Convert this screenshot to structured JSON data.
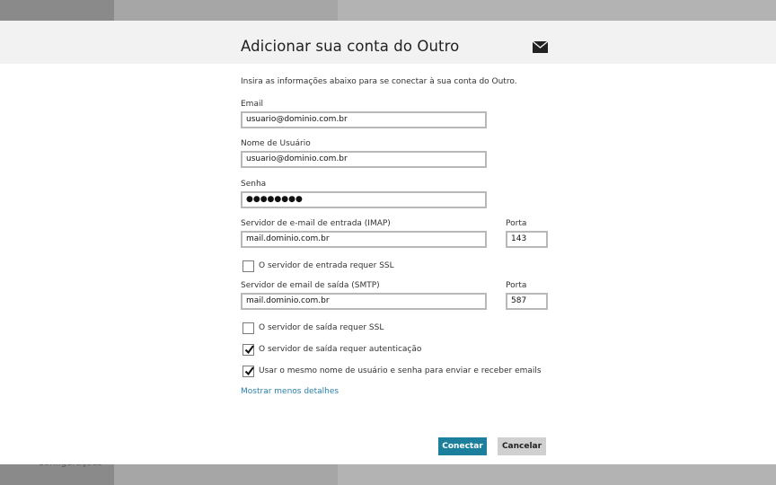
{
  "background": {
    "footer_label": "Configurações"
  },
  "dialog": {
    "title": "Adicionar sua conta do Outro",
    "intro": "Insira as informações abaixo para se conectar à sua conta do Outro.",
    "email": {
      "label": "Email",
      "value": "usuario@dominio.com.br"
    },
    "username": {
      "label": "Nome de Usuário",
      "value": "usuario@dominio.com.br"
    },
    "password": {
      "label": "Senha",
      "value": "●●●●●●●●"
    },
    "incoming": {
      "label": "Servidor de e-mail de entrada (IMAP)",
      "value": "mail.dominio.com.br",
      "port_label": "Porta",
      "port_value": "143"
    },
    "incoming_ssl": {
      "label": "O servidor de entrada requer SSL",
      "checked": false
    },
    "outgoing": {
      "label": "Servidor de email de saída (SMTP)",
      "value": "mail.dominio.com.br",
      "port_label": "Porta",
      "port_value": "587"
    },
    "outgoing_ssl": {
      "label": "O servidor de saída requer SSL",
      "checked": false
    },
    "outgoing_auth": {
      "label": "O servidor de saída requer autenticação",
      "checked": true
    },
    "same_credentials": {
      "label": "Usar o mesmo nome de usuário e senha para enviar e receber emails",
      "checked": true
    },
    "less_details_link": "Mostrar menos detalhes",
    "connect_label": "Conectar",
    "cancel_label": "Cancelar"
  },
  "icons": {
    "mail": "envelope-icon",
    "check": "checkmark-icon"
  },
  "colors": {
    "primary_button": "#1c7f9c",
    "link": "#2a7fa8",
    "header_bg": "#f2f2f2"
  }
}
